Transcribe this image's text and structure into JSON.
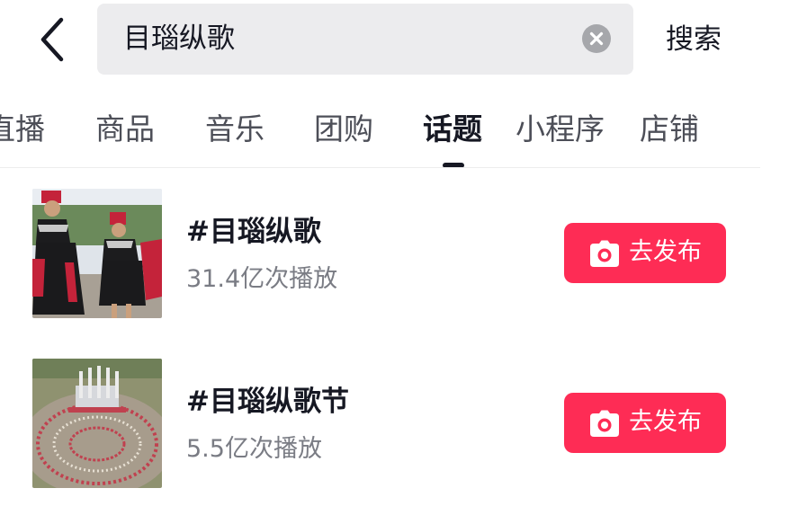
{
  "header": {
    "back_icon": "chevron-left-icon",
    "search_query": "目瑙纵歌",
    "clear_icon": "clear-circle-icon",
    "search_action_label": "搜索"
  },
  "tabs": [
    {
      "label": "直播",
      "active": false
    },
    {
      "label": "商品",
      "active": false
    },
    {
      "label": "音乐",
      "active": false
    },
    {
      "label": "团购",
      "active": false
    },
    {
      "label": "话题",
      "active": true
    },
    {
      "label": "小程序",
      "active": false
    },
    {
      "label": "店铺",
      "active": false
    }
  ],
  "topics": [
    {
      "title": "#目瑙纵歌",
      "plays": "31.4亿次播放",
      "button_label": "去发布",
      "button_icon": "camera-icon"
    },
    {
      "title": "#目瑙纵歌节",
      "plays": "5.5亿次播放",
      "button_label": "去发布",
      "button_icon": "camera-icon"
    }
  ],
  "colors": {
    "accent": "#fe2c55",
    "text_primary": "#161823",
    "text_secondary": "#7a7c84",
    "search_bg": "#ececee"
  }
}
